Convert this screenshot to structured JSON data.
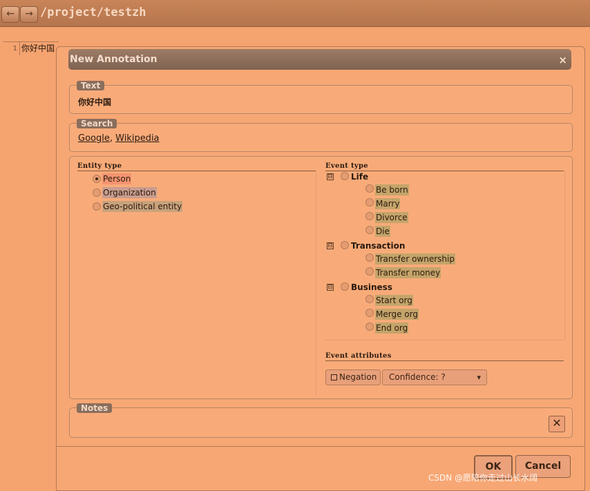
{
  "header": {
    "title": "/project/testzh",
    "back_icon": "←",
    "forward_icon": "→"
  },
  "editor": {
    "line_number": "1",
    "line_text": "你好中国"
  },
  "dialog": {
    "title": "New Annotation",
    "close_icon": "×",
    "text_section": {
      "legend": "Text",
      "value": "你好中国"
    },
    "search_section": {
      "legend": "Search",
      "link1": "Google",
      "separator": ",",
      "link2": "Wikipedia"
    },
    "entity": {
      "title": "Entity type",
      "options": [
        {
          "label": "Person",
          "checked": true
        },
        {
          "label": "Organization",
          "checked": false
        },
        {
          "label": "Geo-political entity",
          "checked": false
        }
      ]
    },
    "event": {
      "title": "Event type",
      "groups": [
        {
          "label": "Life",
          "items": [
            "Be born",
            "Marry",
            "Divorce",
            "Die"
          ]
        },
        {
          "label": "Transaction",
          "items": [
            "Transfer ownership",
            "Transfer money"
          ]
        },
        {
          "label": "Business",
          "items": [
            "Start org",
            "Merge org",
            "End org"
          ]
        }
      ],
      "collapse_icon": "⊟"
    },
    "attributes": {
      "title": "Event attributes",
      "negation": "Negation",
      "confidence": "Confidence: ?",
      "dropdown_icon": "▾"
    },
    "notes": {
      "legend": "Notes",
      "clear_icon": "✕"
    },
    "ok": "OK",
    "cancel": "Cancel"
  },
  "watermark": "CSDN @愿陪你走过山长水阔"
}
